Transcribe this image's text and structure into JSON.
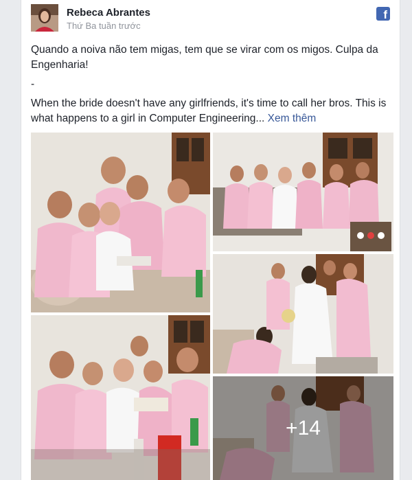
{
  "post": {
    "author": "Rebeca Abrantes",
    "timestamp": "Thứ Ba tuần trước",
    "text_pt": "Quando a noiva não tem migas, tem que se virar com os migos. Culpa da Engenharia!",
    "separator": "-",
    "text_en": "When the bride doesn't have any girlfriends, it's time to call her bros. This is what happens to a girl in Computer Engineering...",
    "see_more": "Xem thêm"
  },
  "brand": {
    "icon": "facebook-icon",
    "color": "#4267b2",
    "glyph": "f"
  },
  "photos": {
    "more_count": "+14"
  },
  "colors": {
    "robe_pink": "#f0b8cc",
    "wall": "#ece9e4",
    "link": "#385898"
  }
}
